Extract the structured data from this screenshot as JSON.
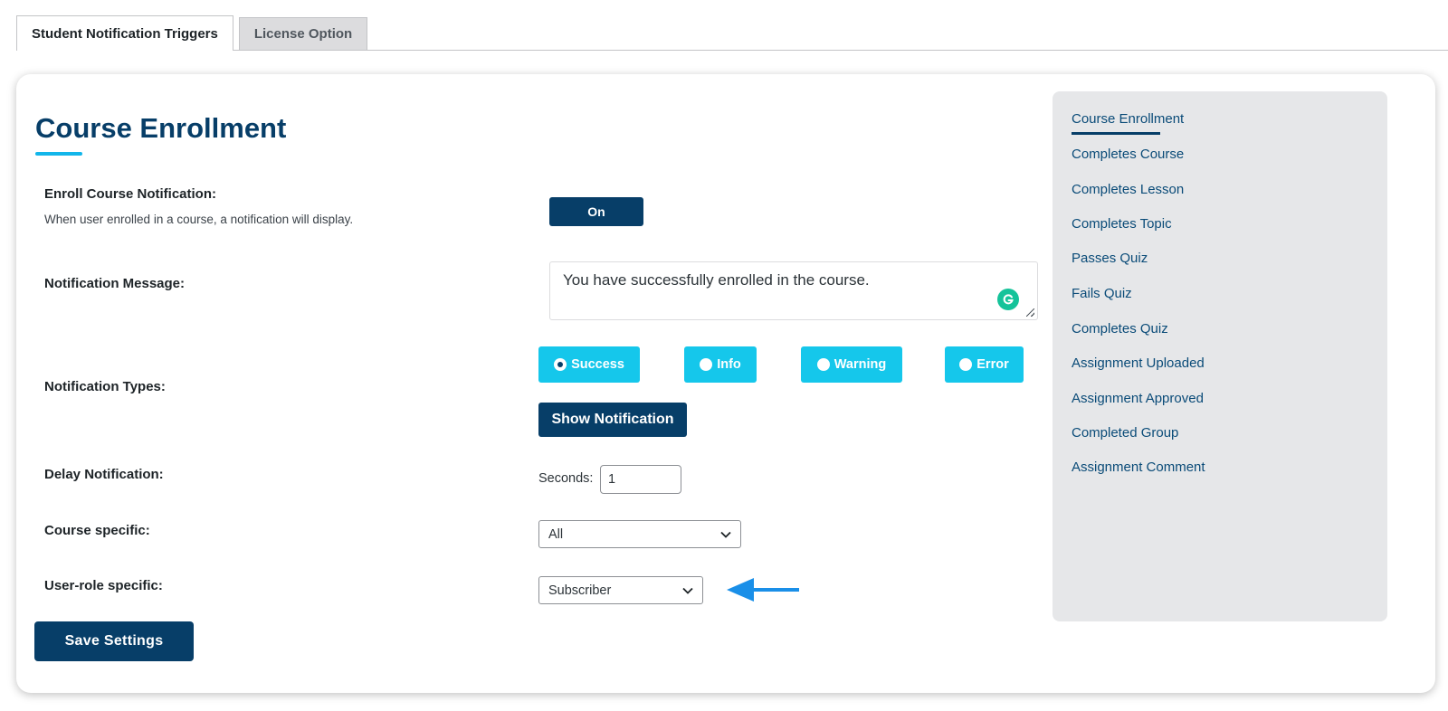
{
  "tabs": [
    {
      "label": "Student Notification Triggers",
      "active": true
    },
    {
      "label": "License Option",
      "active": false
    }
  ],
  "section": {
    "title": "Course Enrollment"
  },
  "form": {
    "enroll": {
      "label": "Enroll Course Notification:",
      "description": "When user enrolled in a course, a notification will display.",
      "toggle_label": "On"
    },
    "message": {
      "label": "Notification Message:",
      "value": "You have successfully enrolled in the course."
    },
    "types": {
      "label": "Notification Types:",
      "options": [
        {
          "label": "Success",
          "checked": true
        },
        {
          "label": "Info",
          "checked": false
        },
        {
          "label": "Warning",
          "checked": false
        },
        {
          "label": "Error",
          "checked": false
        }
      ],
      "show_button": "Show Notification"
    },
    "delay": {
      "label": "Delay Notification:",
      "seconds_label": "Seconds:",
      "value": "1"
    },
    "course_specific": {
      "label": "Course specific:",
      "selected": "All"
    },
    "role_specific": {
      "label": "User-role specific:",
      "selected": "Subscriber"
    },
    "save_label": "Save Settings"
  },
  "sidebar": {
    "items": [
      {
        "label": "Course Enrollment",
        "active": true
      },
      {
        "label": "Completes Course"
      },
      {
        "label": "Completes Lesson"
      },
      {
        "label": "Completes Topic"
      },
      {
        "label": "Passes Quiz"
      },
      {
        "label": "Fails Quiz"
      },
      {
        "label": "Completes Quiz"
      },
      {
        "label": "Assignment Uploaded"
      },
      {
        "label": "Assignment Approved"
      },
      {
        "label": "Completed Group"
      },
      {
        "label": "Assignment Comment"
      }
    ]
  },
  "colors": {
    "primary": "#073e68",
    "accent": "#15c7eb",
    "arrow": "#1a8fe8",
    "grammarly": "#15c39a"
  },
  "icons": {
    "grammarly": "grammarly-icon",
    "chevron": "chevron-down-icon",
    "pointer": "arrow-left-icon"
  }
}
